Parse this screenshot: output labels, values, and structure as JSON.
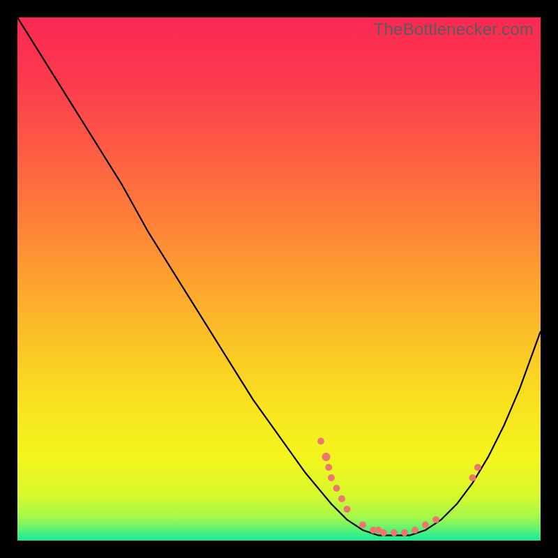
{
  "watermark": "TheBottleneсker.com",
  "chart_data": {
    "type": "line",
    "title": "",
    "xlabel": "",
    "ylabel": "",
    "xlim": [
      0,
      100
    ],
    "ylim": [
      0,
      100
    ],
    "grid": false,
    "axes_visible": false,
    "series": [
      {
        "name": "curve",
        "color": "#000000",
        "x": [
          0,
          5,
          10,
          15,
          20,
          25,
          30,
          35,
          40,
          45,
          50,
          55,
          60,
          63,
          66,
          69,
          72,
          75,
          78,
          81,
          84,
          87,
          90,
          93,
          96,
          100
        ],
        "y": [
          100,
          92,
          84,
          76,
          68,
          59,
          51,
          43,
          35,
          27,
          20,
          13,
          7,
          4,
          2,
          1,
          1,
          1,
          2,
          4,
          7,
          11,
          16,
          22,
          29,
          40
        ]
      }
    ],
    "markers": [
      {
        "x": 58,
        "y": 19,
        "r": 5,
        "color": "#ee766d"
      },
      {
        "x": 59,
        "y": 16,
        "r": 6,
        "color": "#ee766d"
      },
      {
        "x": 59.5,
        "y": 14,
        "r": 5,
        "color": "#ee766d"
      },
      {
        "x": 60,
        "y": 12,
        "r": 5,
        "color": "#ee766d"
      },
      {
        "x": 61,
        "y": 10,
        "r": 5,
        "color": "#ee766d"
      },
      {
        "x": 62,
        "y": 8,
        "r": 5,
        "color": "#ee766d"
      },
      {
        "x": 63,
        "y": 6,
        "r": 5,
        "color": "#ee766d"
      },
      {
        "x": 66,
        "y": 3,
        "r": 5,
        "color": "#ee766d"
      },
      {
        "x": 68,
        "y": 2,
        "r": 5,
        "color": "#ee766d"
      },
      {
        "x": 69,
        "y": 2,
        "r": 5,
        "color": "#ee766d"
      },
      {
        "x": 70,
        "y": 1.5,
        "r": 5,
        "color": "#ee766d"
      },
      {
        "x": 72,
        "y": 1.5,
        "r": 5,
        "color": "#ee766d"
      },
      {
        "x": 74,
        "y": 1.5,
        "r": 5,
        "color": "#ee766d"
      },
      {
        "x": 76,
        "y": 2,
        "r": 5,
        "color": "#ee766d"
      },
      {
        "x": 78,
        "y": 3,
        "r": 5,
        "color": "#ee766d"
      },
      {
        "x": 80,
        "y": 4,
        "r": 5,
        "color": "#ee766d"
      },
      {
        "x": 87,
        "y": 12,
        "r": 5,
        "color": "#ee766d"
      },
      {
        "x": 88,
        "y": 14,
        "r": 5,
        "color": "#ee766d"
      }
    ],
    "background_gradient": {
      "type": "vertical",
      "stops": [
        {
          "offset": 0.0,
          "color": "#fb2854"
        },
        {
          "offset": 0.12,
          "color": "#fc3a4e"
        },
        {
          "offset": 0.25,
          "color": "#fd5b44"
        },
        {
          "offset": 0.38,
          "color": "#fd7e39"
        },
        {
          "offset": 0.5,
          "color": "#fca12f"
        },
        {
          "offset": 0.62,
          "color": "#fbc326"
        },
        {
          "offset": 0.74,
          "color": "#f9e21f"
        },
        {
          "offset": 0.84,
          "color": "#f3f51e"
        },
        {
          "offset": 0.91,
          "color": "#d9f82b"
        },
        {
          "offset": 0.955,
          "color": "#a6f84a"
        },
        {
          "offset": 0.978,
          "color": "#5ef373"
        },
        {
          "offset": 1.0,
          "color": "#15ea9c"
        }
      ]
    }
  }
}
